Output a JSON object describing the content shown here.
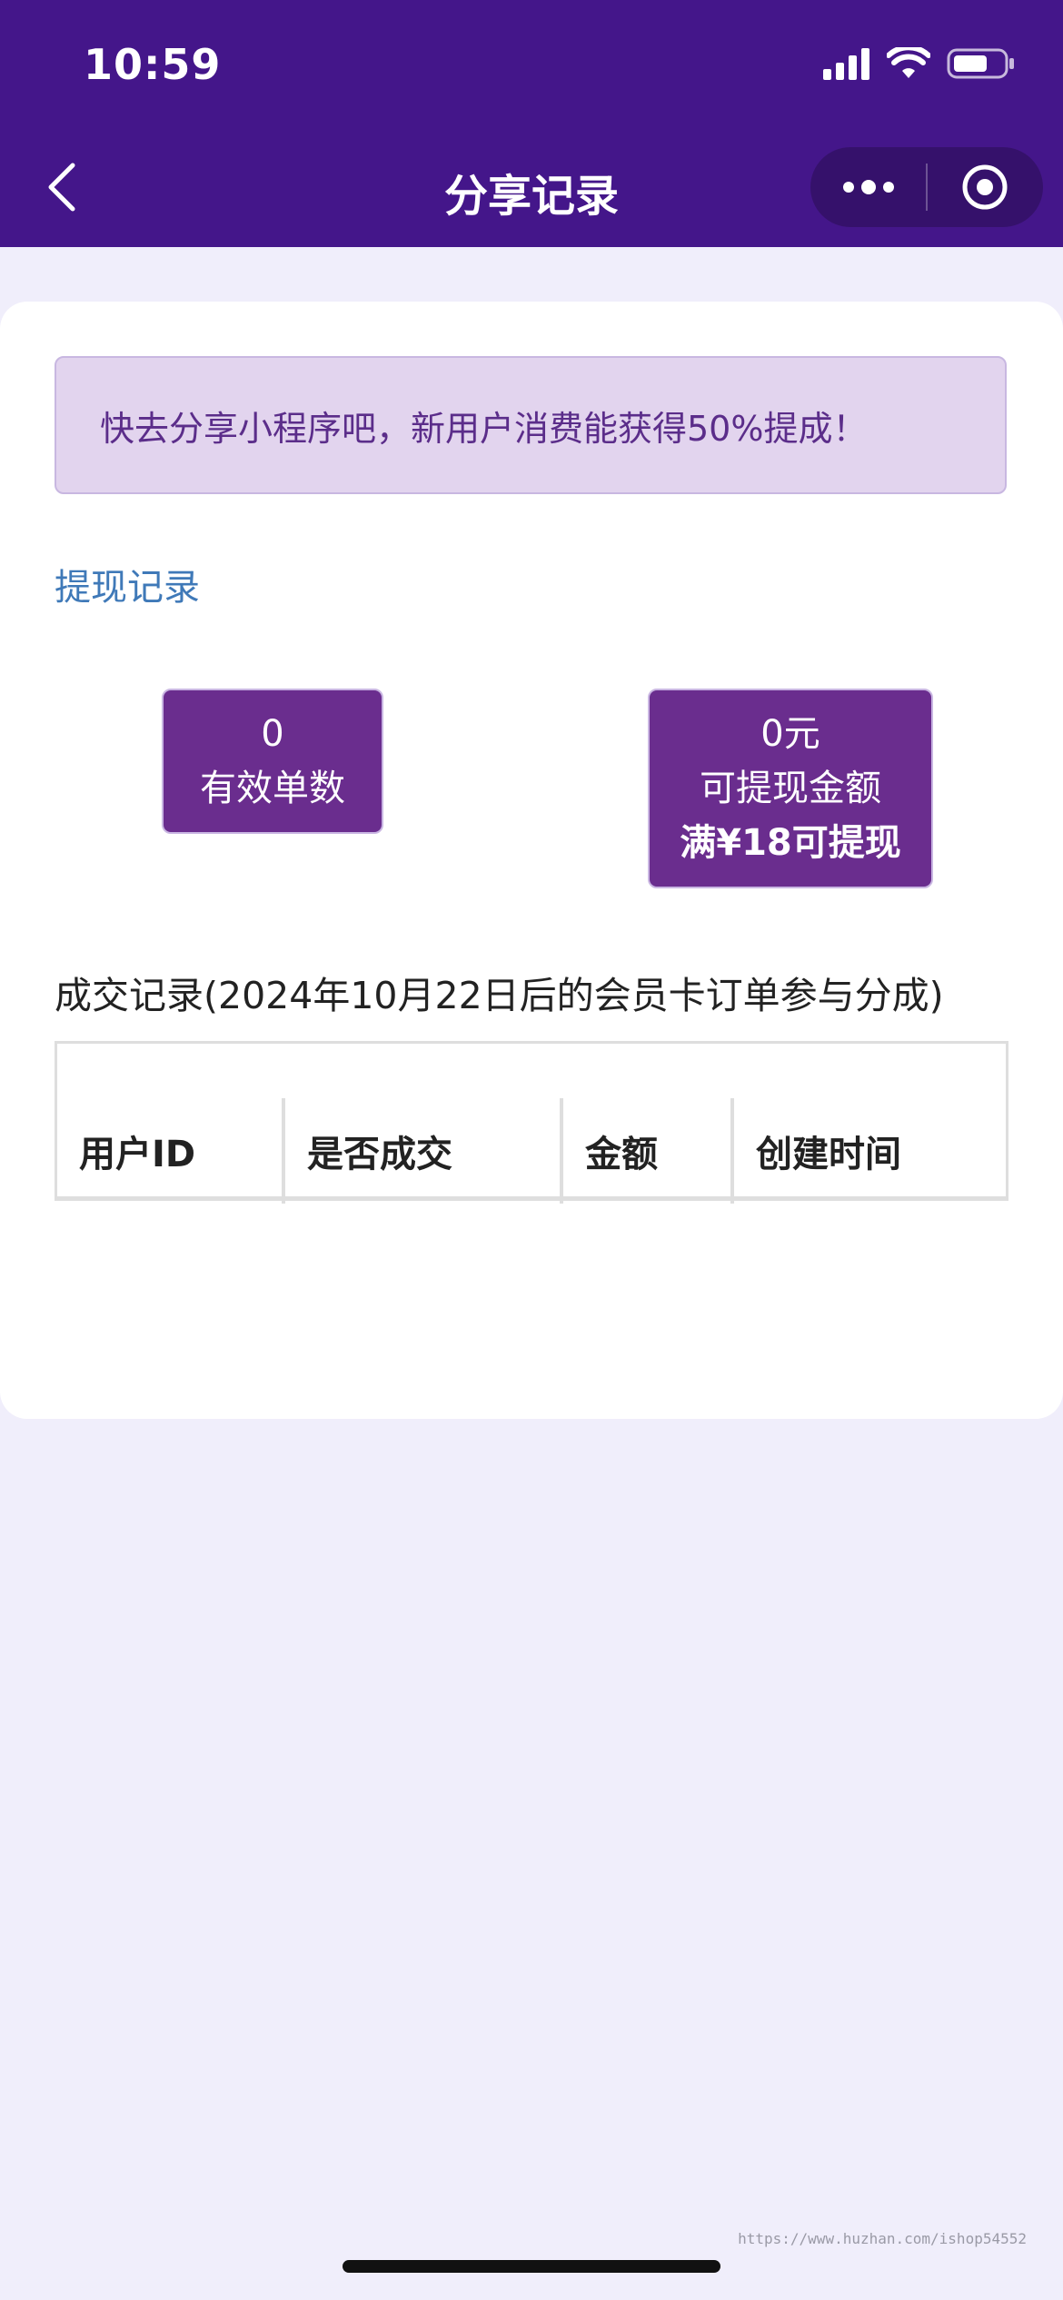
{
  "status_bar": {
    "time": "10:59"
  },
  "nav": {
    "title": "分享记录"
  },
  "notice": {
    "text": "快去分享小程序吧，新用户消费能获得50%提成！"
  },
  "withdraw_link": "提现记录",
  "stats": {
    "orders": {
      "value": "0",
      "label": "有效单数"
    },
    "amount": {
      "value": "0元",
      "label": "可提现金额",
      "rule": "满¥18可提现"
    }
  },
  "records": {
    "title": "成交记录(2024年10月22日后的会员卡订单参与分成)",
    "columns": [
      "用户ID",
      "是否成交",
      "金额",
      "创建时间"
    ],
    "rows": []
  },
  "watermark": "https://www.huzhan.com/ishop54552",
  "colors": {
    "header_bg": "#44168a",
    "accent_purple": "#6a2d8e",
    "notice_bg": "#e2d4ee",
    "notice_text": "#5b2d8a",
    "link_blue": "#3f79b8",
    "page_bg": "#f0eefb"
  },
  "icons": {
    "back": "chevron-left-icon",
    "more": "more-dots-icon",
    "close": "target-circle-icon",
    "signal": "cellular-signal-icon",
    "wifi": "wifi-icon",
    "battery": "battery-icon"
  }
}
